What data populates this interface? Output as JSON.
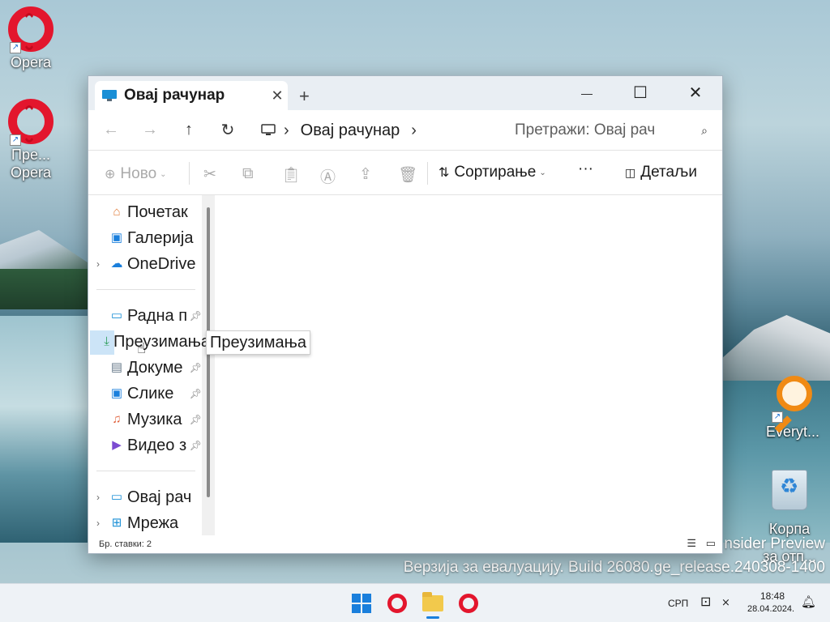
{
  "desktop": {
    "icons": [
      {
        "label": "Opera"
      },
      {
        "label": "Пре...",
        "label2": "Opera"
      },
      {
        "label": "Everyt..."
      },
      {
        "label": "Корпа",
        "label2": "за отп..."
      }
    ],
    "watermark_line1": "nsider Preview",
    "watermark_line2": "Верзија за евалуацију. Build 26080.ge_release.240308-1400"
  },
  "window": {
    "tab_title": "Овај рачунар",
    "tab_close": "✕",
    "new_tab": "+",
    "controls": {
      "minimize": "—",
      "maximize": "☐",
      "close": "✕"
    },
    "nav": {
      "back": "←",
      "forward": "→",
      "up": "↑",
      "refresh": "↻"
    },
    "address": {
      "location": "Овај рачунар",
      "chevron": "›"
    },
    "search": {
      "placeholder": "Претражи: Овај рач",
      "icon": "⌕"
    },
    "commands": {
      "new": "Ново",
      "sort": "Сортирање",
      "more": "···",
      "details": "Детаљи"
    },
    "sidebar": {
      "items": [
        {
          "label": "Почетак",
          "icon": "home-icon"
        },
        {
          "label": "Галерија",
          "icon": "gallery-icon"
        },
        {
          "label": "OneDrive",
          "icon": "onedrive-icon",
          "expandable": true
        },
        {
          "label": "Радна п",
          "icon": "desktop-icon",
          "pinned": true
        },
        {
          "label": "Преузимања",
          "icon": "download-icon",
          "pinned": true
        },
        {
          "label": "Докуме",
          "icon": "document-icon",
          "pinned": true
        },
        {
          "label": "Слике",
          "icon": "pictures-icon",
          "pinned": true
        },
        {
          "label": "Музика",
          "icon": "music-icon",
          "pinned": true
        },
        {
          "label": "Видео з",
          "icon": "video-icon",
          "pinned": true
        },
        {
          "label": "Овај рач",
          "icon": "this-pc-icon",
          "expandable": true
        },
        {
          "label": "Мрежа",
          "icon": "network-icon",
          "expandable": true
        }
      ],
      "tooltip": "Преузимања"
    },
    "status": "Бр. ставки: 2"
  },
  "taskbar": {
    "language": "СРП",
    "time": "18:48",
    "date": "28.04.2024."
  },
  "colors": {
    "accent": "#1a7fdc",
    "opera_red": "#e3162d"
  }
}
